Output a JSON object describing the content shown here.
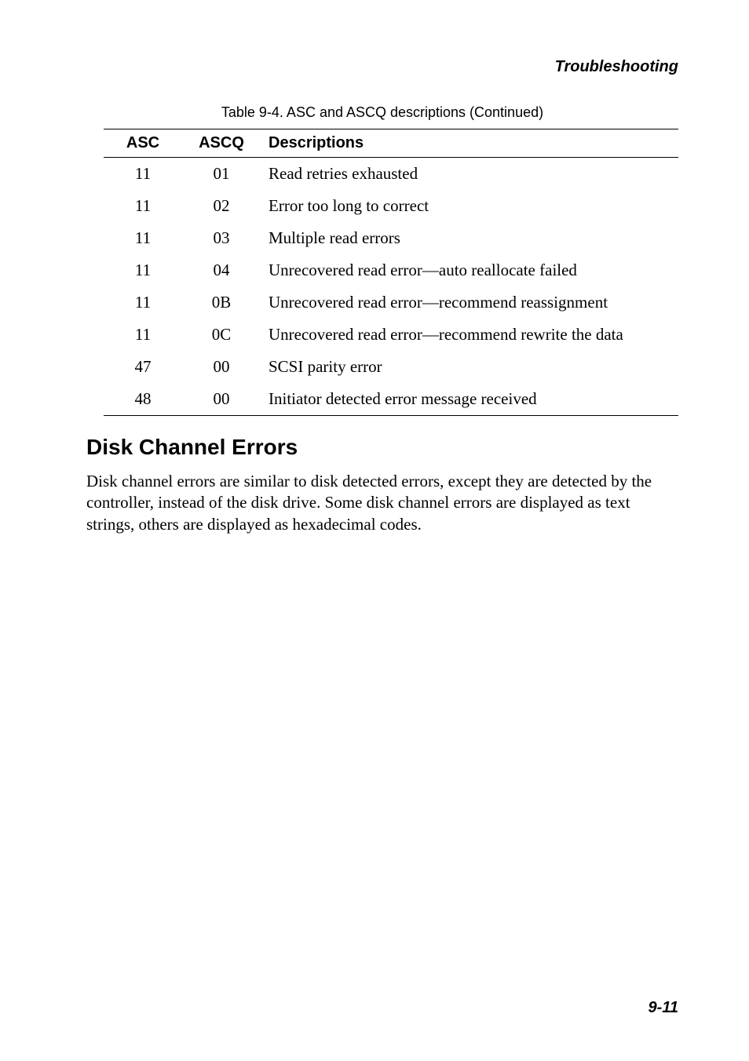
{
  "running_head": "Troubleshooting",
  "table": {
    "caption": "Table 9-4. ASC and ASCQ descriptions (Continued)",
    "headers": {
      "asc": "ASC",
      "ascq": "ASCQ",
      "desc": "Descriptions"
    },
    "rows": [
      {
        "asc": "11",
        "ascq": "01",
        "desc": "Read retries exhausted"
      },
      {
        "asc": "11",
        "ascq": "02",
        "desc": "Error too long to correct"
      },
      {
        "asc": "11",
        "ascq": "03",
        "desc": "Multiple read errors"
      },
      {
        "asc": "11",
        "ascq": "04",
        "desc": "Unrecovered read error—auto reallocate failed"
      },
      {
        "asc": "11",
        "ascq": "0B",
        "desc": "Unrecovered read error—recommend reassignment"
      },
      {
        "asc": "11",
        "ascq": "0C",
        "desc": "Unrecovered read error—recommend rewrite the data"
      },
      {
        "asc": "47",
        "ascq": "00",
        "desc": "SCSI parity error"
      },
      {
        "asc": "48",
        "ascq": "00",
        "desc": "Initiator detected error message received"
      }
    ]
  },
  "section": {
    "heading": "Disk Channel Errors",
    "body": "Disk channel errors are similar to disk detected errors, except they are detected by the controller, instead of the disk drive. Some disk channel errors are displayed as text strings, others are displayed as hexadecimal codes."
  },
  "page_number": "9-11"
}
